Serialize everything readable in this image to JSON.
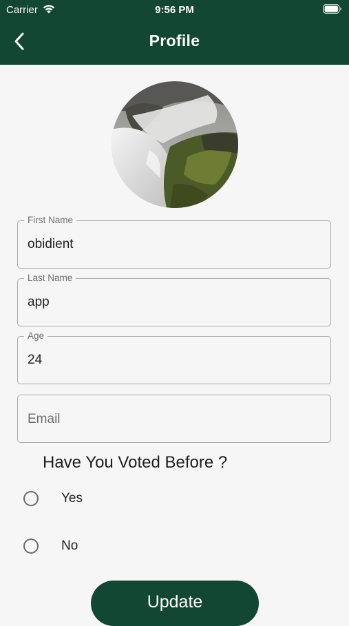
{
  "status_bar": {
    "carrier": "Carrier",
    "time": "9:56 PM"
  },
  "nav": {
    "title": "Profile",
    "back_icon": "chevron-left-icon"
  },
  "form": {
    "first_name": {
      "label": "First Name",
      "value": "obidient"
    },
    "last_name": {
      "label": "Last Name",
      "value": "app"
    },
    "age": {
      "label": "Age",
      "value": "24"
    },
    "email": {
      "placeholder": "Email",
      "value": ""
    }
  },
  "vote": {
    "question": "Have You Voted Before ?",
    "options": [
      {
        "label": "Yes",
        "selected": false
      },
      {
        "label": "No",
        "selected": false
      }
    ]
  },
  "update_button": {
    "label": "Update"
  },
  "colors": {
    "primary": "#124734",
    "background": "#f6f6f6"
  }
}
